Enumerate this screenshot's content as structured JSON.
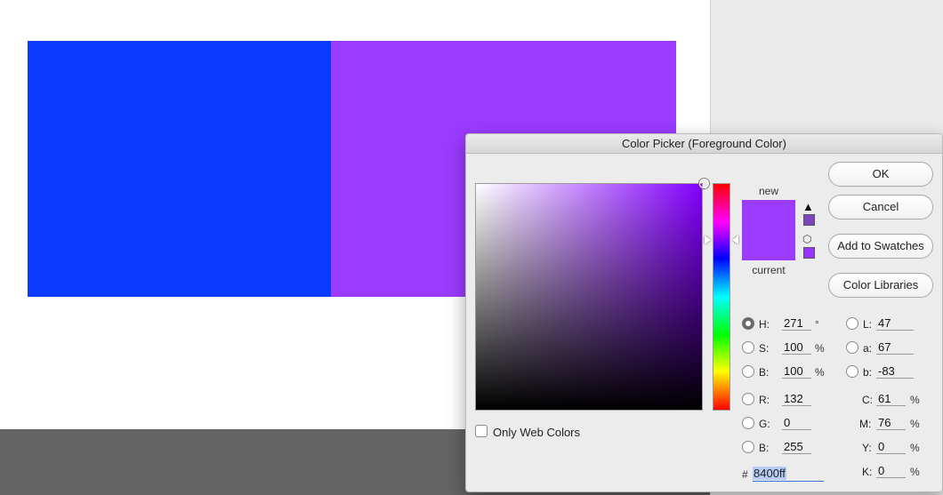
{
  "canvas": {
    "left_rect_color": "#0a3bff",
    "right_rect_color": "#9a3bff"
  },
  "dialog": {
    "title": "Color Picker (Foreground Color)",
    "buttons": {
      "ok": "OK",
      "cancel": "Cancel",
      "add_to_swatches": "Add to Swatches",
      "color_libraries": "Color Libraries"
    },
    "preview": {
      "new_label": "new",
      "current_label": "current",
      "new_color": "#9a3bff",
      "current_color": "#9a3bff",
      "gamut_warning_icon": "warning-triangle-icon",
      "web_safe_icon": "cube-icon",
      "gamut_swatch_color": "#7d45c0",
      "web_swatch_color": "#9933ff"
    },
    "hsb": {
      "h": {
        "label": "H:",
        "value": "271",
        "unit": "°"
      },
      "s": {
        "label": "S:",
        "value": "100",
        "unit": "%"
      },
      "b": {
        "label": "B:",
        "value": "100",
        "unit": "%"
      }
    },
    "rgb": {
      "r": {
        "label": "R:",
        "value": "132"
      },
      "g": {
        "label": "G:",
        "value": "0"
      },
      "b": {
        "label": "B:",
        "value": "255"
      }
    },
    "lab": {
      "l": {
        "label": "L:",
        "value": "47"
      },
      "a": {
        "label": "a:",
        "value": "67"
      },
      "b": {
        "label": "b:",
        "value": "-83"
      }
    },
    "cmyk": {
      "c": {
        "label": "C:",
        "value": "61",
        "unit": "%"
      },
      "m": {
        "label": "M:",
        "value": "76",
        "unit": "%"
      },
      "y": {
        "label": "Y:",
        "value": "0",
        "unit": "%"
      },
      "k": {
        "label": "K:",
        "value": "0",
        "unit": "%"
      }
    },
    "hex": {
      "label": "#",
      "value": "8400ff"
    },
    "only_web_colors": {
      "label": "Only Web Colors",
      "checked": false
    },
    "color_field_hue_color": "#8400ff"
  }
}
